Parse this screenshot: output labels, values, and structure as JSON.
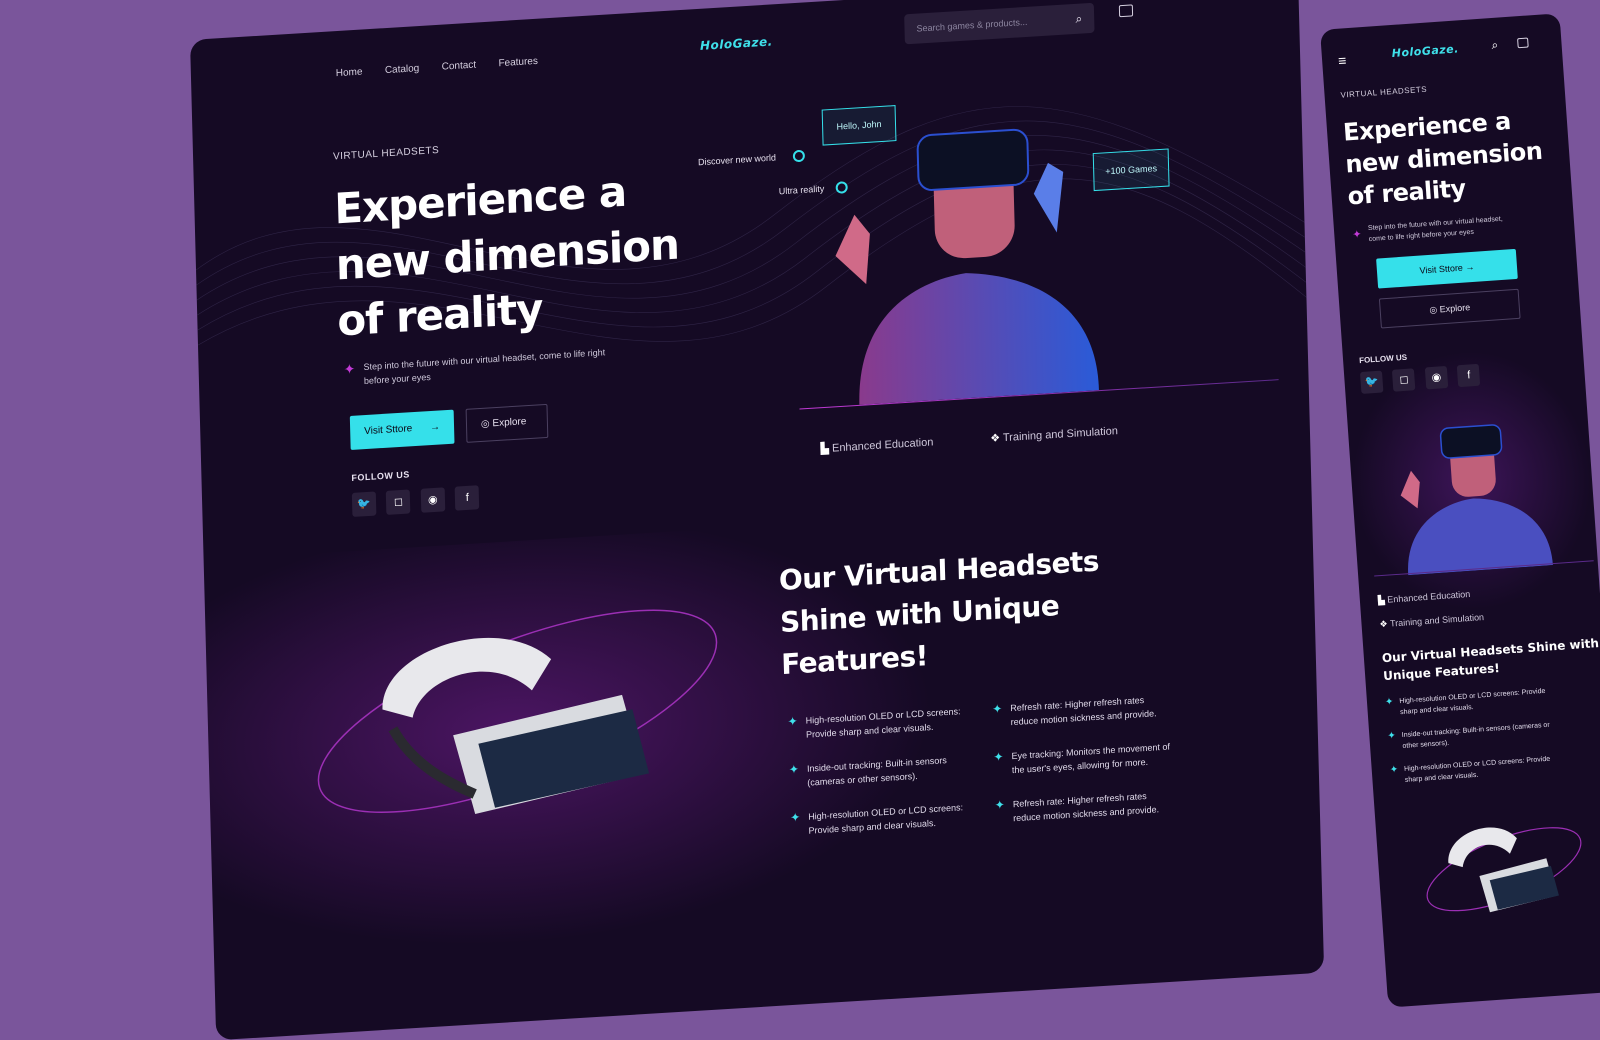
{
  "brand": {
    "name": "HoloGaze."
  },
  "colors": {
    "background": "#7a559b",
    "page": "#150a24",
    "accent": "#35e0ea",
    "magenta": "#c23ad6"
  },
  "desktop": {
    "nav": [
      {
        "label": "Home"
      },
      {
        "label": "Catalog"
      },
      {
        "label": "Contact"
      },
      {
        "label": "Features"
      }
    ],
    "search": {
      "placeholder": "Search games & products..."
    },
    "hero": {
      "kicker": "VIRTUAL HEADSETS",
      "title_line1": "Experience a",
      "title_line2": "new dimension",
      "title_line3": "of reality",
      "subtitle_line1": "Step into the future with our virtual headset, come to life right",
      "subtitle_line2": "before your eyes",
      "primary_button": "Visit Sttore",
      "secondary_button": "Explore"
    },
    "follow_label": "FOLLOW US",
    "callouts": {
      "hello": "Hello, John",
      "discover": "Discover new world",
      "ultra": "Ultra reality",
      "games": "+100 Games"
    },
    "features_strip": [
      {
        "label": "Enhanced Education"
      },
      {
        "label": "Training and Simulation"
      }
    ],
    "section": {
      "title_line1": "Our Virtual Headsets",
      "title_line2": "Shine with Unique",
      "title_line3": "Features!",
      "bullets": [
        {
          "line1": "High-resolution OLED or LCD screens:",
          "line2": "Provide sharp and clear visuals."
        },
        {
          "line1": "Refresh rate: Higher refresh rates",
          "line2": "reduce motion sickness and provide."
        },
        {
          "line1": "Inside-out tracking: Built-in sensors",
          "line2": "(cameras or other sensors)."
        },
        {
          "line1": "Eye tracking: Monitors the movement of",
          "line2": "the user's eyes, allowing for more."
        },
        {
          "line1": "High-resolution OLED or LCD screens:",
          "line2": "Provide sharp and clear visuals."
        },
        {
          "line1": "Refresh rate: Higher refresh rates",
          "line2": "reduce motion sickness and provide."
        }
      ]
    }
  },
  "mobile": {
    "kicker": "VIRTUAL HEADSETS",
    "title_line1": "Experience a",
    "title_line2": "new dimension",
    "title_line3": "of reality",
    "subtitle_line1": "Step into the future with our virtual headset,",
    "subtitle_line2": "come to life right before your eyes",
    "primary_button": "Visit Sttore",
    "secondary_button": "Explore",
    "follow_label": "FOLLOW US",
    "features_strip": [
      {
        "label": "Enhanced Education"
      },
      {
        "label": "Training and Simulation"
      }
    ],
    "section_title_line1": "Our Virtual Headsets Shine with",
    "section_title_line2": "Unique Features!",
    "bullets": [
      {
        "line1": "High-resolution OLED or LCD screens: Provide",
        "line2": "sharp and clear visuals."
      },
      {
        "line1": "Inside-out tracking: Built-in sensors (cameras or",
        "line2": "other sensors)."
      },
      {
        "line1": "High-resolution OLED or LCD screens: Provide",
        "line2": "sharp and clear visuals."
      }
    ]
  }
}
